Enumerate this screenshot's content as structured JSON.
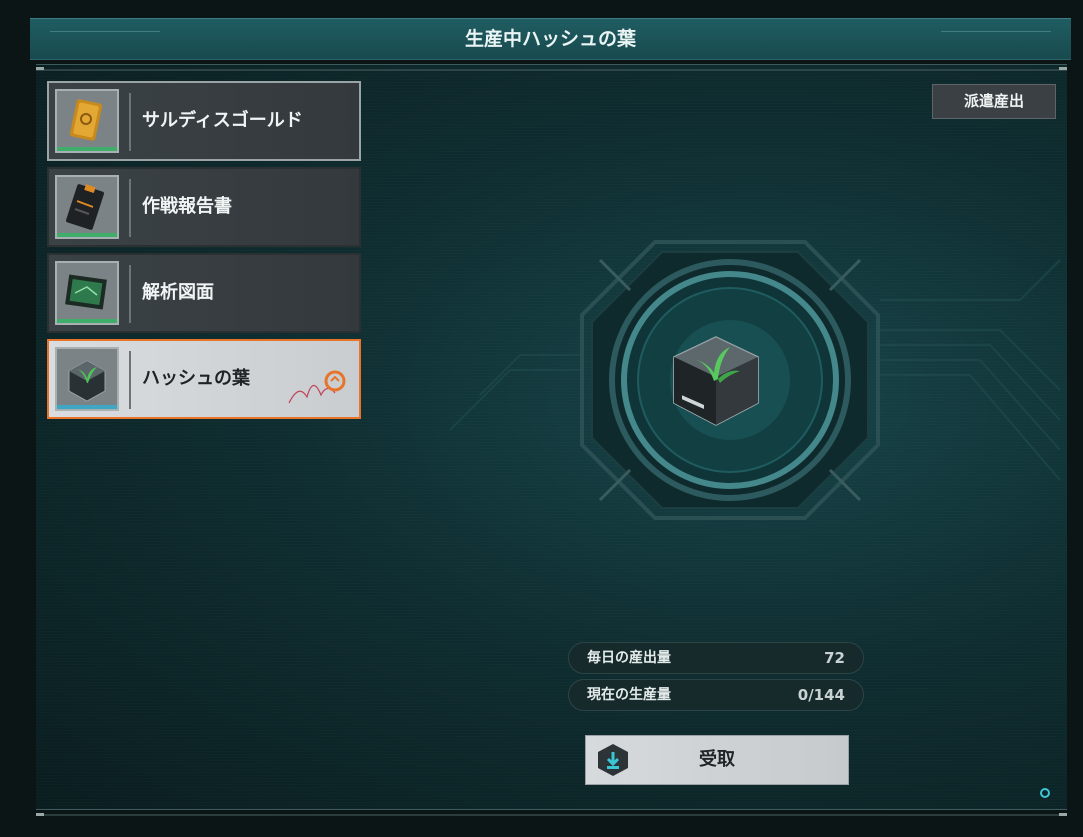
{
  "header": {
    "title": "生産中ハッシュの葉"
  },
  "actions": {
    "dispatch_label": "派遣産出",
    "claim_label": "受取"
  },
  "items": [
    {
      "label": "サルディスゴールド",
      "icon": "gold-bar-icon",
      "selected": false
    },
    {
      "label": "作戦報告書",
      "icon": "report-icon",
      "selected": false
    },
    {
      "label": "解析図面",
      "icon": "blueprint-icon",
      "selected": false
    },
    {
      "label": "ハッシュの葉",
      "icon": "plant-cube-icon",
      "selected": true
    }
  ],
  "stats": {
    "daily_label": "毎日の産出量",
    "daily_value": "72",
    "current_label": "現在の生産量",
    "current_value": "0/144"
  },
  "colors": {
    "accent": "#e8742a",
    "panel": "#184a4e",
    "highlight": "#39c7d6"
  }
}
